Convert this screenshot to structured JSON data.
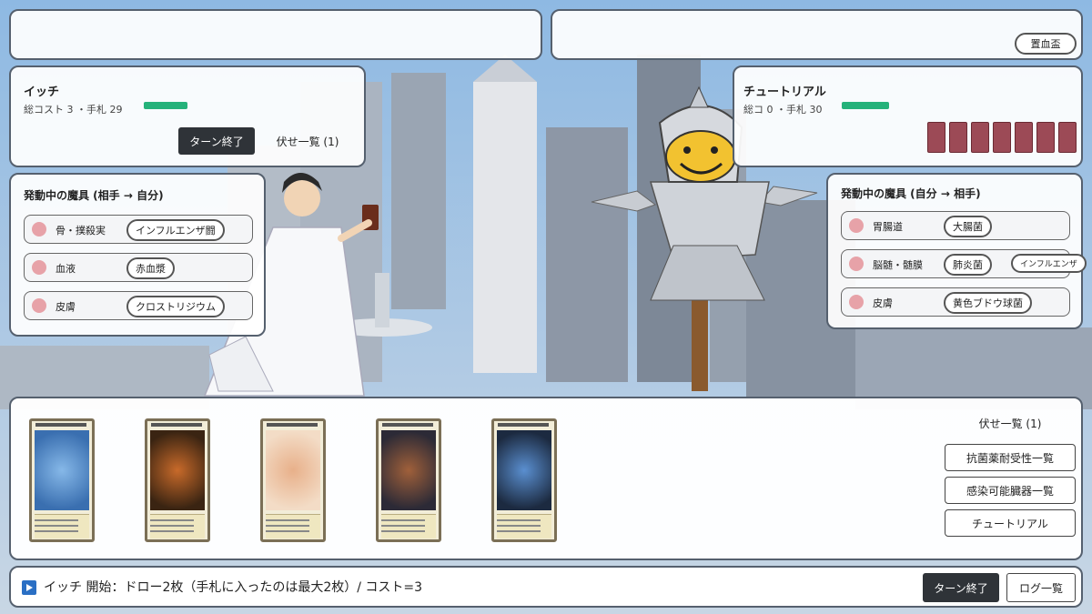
{
  "top_left": {
    "label": ""
  },
  "top_right": {
    "label": "",
    "surrender_label": "置血盃"
  },
  "player": {
    "name": "イッチ",
    "stats": "総コスト 3 ・手札 29",
    "hp_label": "",
    "hp_fraction": 1.0,
    "end_turn_label": "ターン終了",
    "hidden_list_label": "伏せ一覧 (1)"
  },
  "opponent": {
    "name": "チュートリアル",
    "stats": "総コ 0 ・手札 30",
    "hp_label": "",
    "hp_fraction": 1.0,
    "hand_count": 7
  },
  "player_magic": {
    "title": "発動中の魔具 (相手 → 自分)",
    "rows": [
      {
        "icon": "bone-shield-icon",
        "label": "骨・撲殺実",
        "pills": [
          "インフルエンザ闘"
        ]
      },
      {
        "icon": "blood-icon",
        "label": "血液",
        "pills": [
          "赤血漿"
        ]
      },
      {
        "icon": "skin-icon",
        "label": "皮膚",
        "pills": [
          "クロストリジウム"
        ]
      }
    ]
  },
  "opponent_magic": {
    "title": "発動中の魔具 (自分 → 相手)",
    "rows": [
      {
        "icon": "stomach-icon",
        "label": "胃腸道",
        "pills": [
          "大腸菌"
        ]
      },
      {
        "icon": "brain-icon",
        "label": "脳髄・髄膜",
        "pills": [
          "肺炎菌",
          "インフルエンザ"
        ]
      },
      {
        "icon": "skin-icon",
        "label": "皮膚",
        "pills": [
          "黄色ブドウ球菌"
        ]
      }
    ]
  },
  "hand": {
    "cards": [
      {
        "title": "",
        "art": "blue-virus",
        "colors": [
          "#3a6fb0",
          "#86b8e8"
        ]
      },
      {
        "title": "",
        "art": "orange-creature",
        "colors": [
          "#3a2412",
          "#c86a2a"
        ]
      },
      {
        "title": "",
        "art": "pale-sketch",
        "colors": [
          "#f3dcc6",
          "#e8b08a"
        ]
      },
      {
        "title": "",
        "art": "dark-scene",
        "colors": [
          "#2c2a36",
          "#a0603a"
        ]
      },
      {
        "title": "",
        "art": "blue-beast",
        "colors": [
          "#1c2a40",
          "#5a8fd0"
        ]
      }
    ]
  },
  "side_buttons": {
    "hidden_label": "伏せ一覧 (1)",
    "b1": "抗菌薬耐受性一覧",
    "b2": "感染可能臓器一覧",
    "b3": "チュートリアル"
  },
  "log": {
    "text": "イッチ 開始：ドロー2枚（手札に入ったのは最大2枚）/ コスト=3",
    "end_turn_label": "ターン終了",
    "log_label": "ログ一覧"
  },
  "colors": {
    "hp": "#25b27a",
    "dark_button": "#2f3338",
    "hp_text": "#e05a5a"
  }
}
